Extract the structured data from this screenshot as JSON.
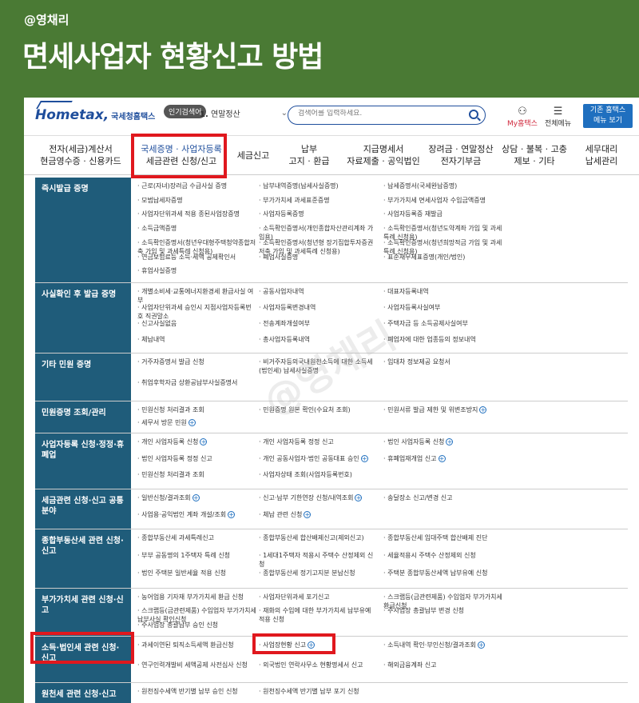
{
  "banner": {
    "handle": "@영채리",
    "headline": "면세사업자 현황신고 방법"
  },
  "header": {
    "logo": "Hometax,",
    "logo_sub": "국세청홈택스",
    "keyword_badge": "인기검색어",
    "keyword_num": "1.",
    "keyword_text": "연말정산",
    "search_placeholder": "검색어를 입력하세요.",
    "myhome": "My홈택스",
    "allmenu": "전체메뉴",
    "basic_menu": [
      "기존 홈택스",
      "메뉴 보기"
    ]
  },
  "nav": [
    [
      "전자(세금)계산서",
      "현금영수증 · 신용카드"
    ],
    [
      "국세증명 · 사업자등록",
      "세금관련 신청/신고"
    ],
    [
      "세금신고"
    ],
    [
      "납부",
      "고지 · 환급"
    ],
    [
      "지급명세서",
      "자료제출 · 공익법인"
    ],
    [
      "장려금 · 연말정산",
      "전자기부금"
    ],
    [
      "상담 · 불복 · 고충",
      "제보 · 기타"
    ],
    [
      "세무대리",
      "납세관리"
    ]
  ],
  "rows": [
    {
      "title": "즉시발급 증명",
      "cells": [
        "근로(자녀)장려금 수급사실 증명",
        "납부내역증명(납세사실증명)",
        "납세증명서(국세완납증명)",
        "모범납세자증명",
        "부가가치세 과세표준증명",
        "부가가치세 면세사업자 수입금액증명",
        "사업자단위과세 적용 종된사업장증명",
        "사업자등록증명",
        "사업자등록증 재발급",
        "소득금액증명",
        "소득확인증명서(개인종합자산관리계좌 가입용)",
        "소득확인증명서(청년도약계좌 가입 및 과세특례 신청용)",
        "소득확인증명서(청년우대형주택청약종합저축 가입 및 과세특례 신청용)",
        "소득확인증명서(청년형 장기집합투자증권저축 가입 및 과세특례 신청용)",
        "소득확인증명서(청년희망적금 가입 및 과세특례 신청용)",
        "연금보험료등 소득·세액 공제확인서",
        "폐업사실증명",
        "표준재무제표증명(개인/법인)",
        "휴업사실증명"
      ]
    },
    {
      "title": "사실확인 후 발급 증명",
      "cells": [
        "개별소비세·교통에너지환경세 환급사실 여부",
        "공동사업자내역",
        "대표자등록내역",
        "사업자단위과세 승인시 지점사업자등록번호 직권말소",
        "사업자등록변경내역",
        "사업자등록사실여부",
        "신고사실없음",
        "전송계좌개설여부",
        "주택자금 등 소득공제사실여부",
        "체납내역",
        "총사업자등록내역",
        "폐업자에 대한 업종등의 정보내역"
      ]
    },
    {
      "title": "기타 민원 증명",
      "cells": [
        "거주자증명서 발급 신청",
        "비거주자등의국내원천소득에 대한 소득세(법인세) 납세사실증명",
        "임대차 정보제공 요청서",
        "취업후학자금 상환공납부사실증명서"
      ]
    },
    {
      "title": "민원증명 조회/관리",
      "cells": [
        "민원신청 처리결과 조회",
        "민원증명 원본 확인(수요처 조회)",
        "민원서류 발급 제한 및 위변조방지",
        "세무서 방문 민원"
      ]
    },
    {
      "title": "사업자등록 신청·정정·휴폐업",
      "cells": [
        "개인 사업자등록 신청",
        "개인 사업자등록 정정 신고",
        "법인 사업자등록 신청",
        "법인 사업자등록 정정 신고",
        "개인 공동사업자·법인 공동대표 승인",
        "휴폐업재개업 신고",
        "민원신청 처리결과 조회",
        "사업자상태 조회(사업자등록번호)"
      ]
    },
    {
      "title": "세금관련 신청·신고 공통분야",
      "cells": [
        "일반신청/결과조회",
        "신고·납부 기한연장 신청/내역조회",
        "송달장소 신고/변경 신고",
        "사업용·공익법인 계좌 개설/조회",
        "체납 관련 신청"
      ]
    },
    {
      "title": "종합부동산세 관련 신청·신고",
      "cells": [
        "종합부동산세 과세특례신고",
        "종합부동산세 합산배제신고(제외신고)",
        "종합부동산세 임대주택 합산배제 진단",
        "부부 공동명의 1주택자 특례 신청",
        "1세대1주택자 적용시 주택수 산정제외 신청",
        "세율적용시 주택수 산정제외 신청",
        "법인 주택분 일반세율 적용 신청",
        "종합부동산세 정기고지분 분납신청",
        "주택분 종합부동산세액 납부유예 신청"
      ]
    },
    {
      "title": "부가가치세 관련 신청·신고",
      "cells": [
        "농어업용 기자재 부가가치세 환급 신청",
        "사업자단위과세 포기신고",
        "스크랩등(금관련제품) 수입업자 부가가치세 환급신청",
        "스크랩등(금관련제품) 수입업자 부가가치세 납부사실 확인신청",
        "재화의 수입에 대한 부가가치세 납부유예 적용 신청",
        "주사업장 총괄납부 변경 신청",
        "주사업장 총괄납부 승인 신청"
      ]
    },
    {
      "title": "소득·법인세 관련 신청·신고",
      "cells": [
        "과세이연된 퇴직소득세액 환급신청",
        "사업장현황 신고",
        "소득내역 확인·부인신청/결과조회",
        "연구인력개발비 세액공제 사전심사 신청",
        "외국법인 연락사무소 현황명세서 신고",
        "해외금융계좌 신고"
      ]
    },
    {
      "title": "원천세 관련 신청·신고",
      "cells": [
        "원천징수세액 반기별 납부 승인 신청",
        "원천징수세액 반기별 납부 포기 신청"
      ]
    }
  ],
  "watermark": "@영채리"
}
